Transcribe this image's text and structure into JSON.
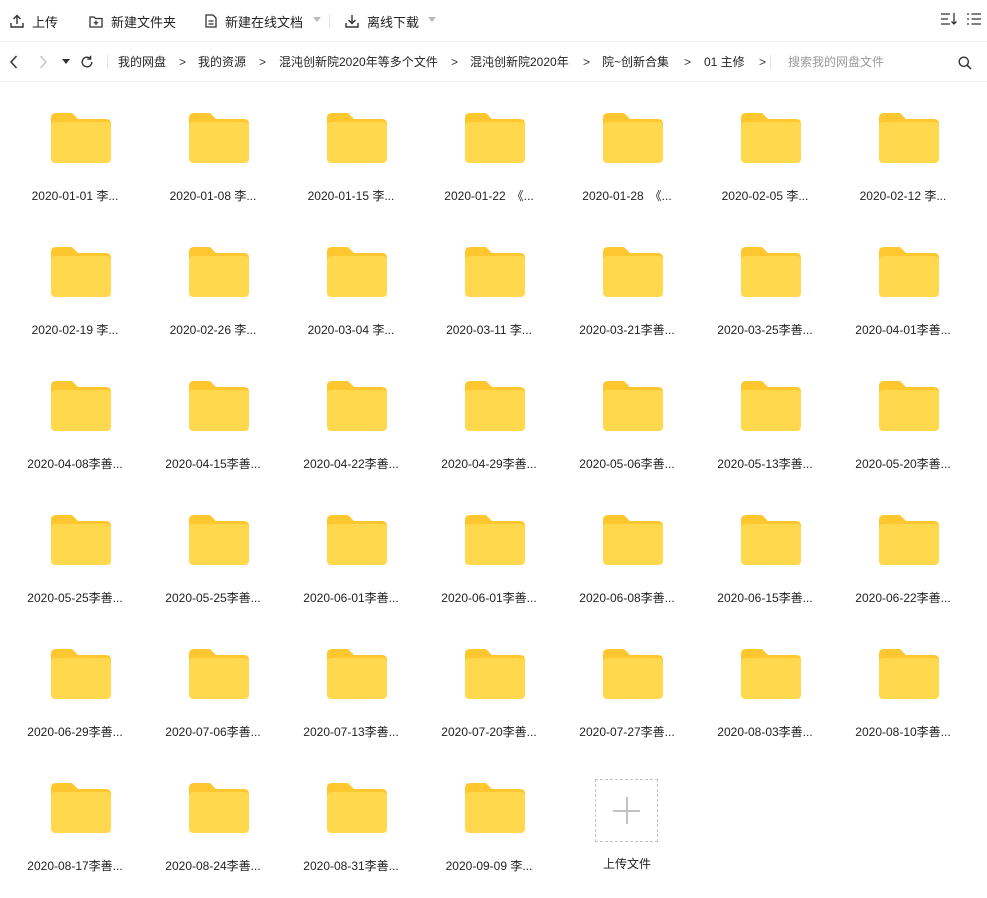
{
  "toolbar": {
    "upload_label": "上传",
    "new_folder_label": "新建文件夹",
    "new_doc_label": "新建在线文档",
    "offline_download_label": "离线下载"
  },
  "nav": {
    "breadcrumbs": [
      "我的网盘",
      "我的资源",
      "混沌创新院2020年等多个文件",
      "混沌创新院2020年",
      "院~创新合集",
      "01 主修"
    ],
    "separator": ">",
    "search_placeholder": "搜索我的网盘文件"
  },
  "folders": [
    "2020-01-01 李...",
    "2020-01-08 李...",
    "2020-01-15 李...",
    "2020-01-22　《...",
    "2020-01-28　《...",
    "2020-02-05 李...",
    "2020-02-12 李...",
    "2020-02-19 李...",
    "2020-02-26 李...",
    "2020-03-04 李...",
    "2020-03-11 李...",
    "2020-03-21李善...",
    "2020-03-25李善...",
    "2020-04-01李善...",
    "2020-04-08李善...",
    "2020-04-15李善...",
    "2020-04-22李善...",
    "2020-04-29李善...",
    "2020-05-06李善...",
    "2020-05-13李善...",
    "2020-05-20李善...",
    "2020-05-25李善...",
    "2020-05-25李善...",
    "2020-06-01李善...",
    "2020-06-01李善...",
    "2020-06-08李善...",
    "2020-06-15李善...",
    "2020-06-22李善...",
    "2020-06-29李善...",
    "2020-07-06李善...",
    "2020-07-13李善...",
    "2020-07-20李善...",
    "2020-07-27李善...",
    "2020-08-03李善...",
    "2020-08-10李善...",
    "2020-08-17李善...",
    "2020-08-24李善...",
    "2020-08-31李善...",
    "2020-09-09 李..."
  ],
  "upload_tile": {
    "label": "上传文件"
  },
  "colors": {
    "folder_front": "#FFD84D",
    "folder_back": "#FFC72F"
  },
  "icons": [
    "upload-icon",
    "new-folder-icon",
    "new-doc-icon",
    "download-icon",
    "sort-icon",
    "list-view-icon",
    "back-arrow-icon",
    "forward-arrow-icon",
    "history-dropdown-icon",
    "refresh-icon",
    "search-icon",
    "folder-icon",
    "plus-icon"
  ]
}
